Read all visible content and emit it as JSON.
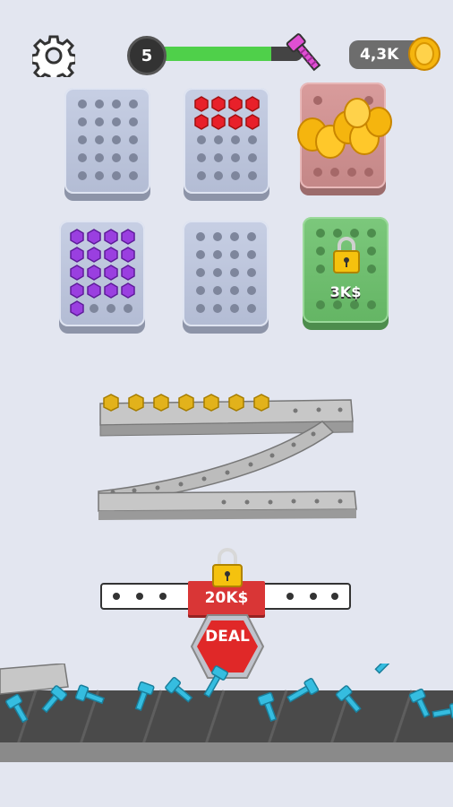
{
  "hud": {
    "level_number": "5",
    "level_progress": 0.78,
    "coins": "4,3K",
    "settings_icon": "gear-icon",
    "goal_icon": "bolt-icon",
    "coin_icon": "coin-icon"
  },
  "boards": [
    {
      "name": "board-empty-1",
      "state": "empty",
      "filled": 0,
      "color": "#b3bcd4"
    },
    {
      "name": "board-red-nuts",
      "state": "partial",
      "filled": 8,
      "nut_color": "#e8202a"
    },
    {
      "name": "board-locked-red",
      "state": "locked",
      "color": "#c48787"
    },
    {
      "name": "board-purple-nuts",
      "state": "partial",
      "filled": 17,
      "nut_color": "#9a3fe0"
    },
    {
      "name": "board-empty-2",
      "state": "empty",
      "filled": 0
    },
    {
      "name": "board-locked-green",
      "state": "locked",
      "price": "3K$",
      "color": "#64b564"
    }
  ],
  "rails": {
    "top_rail_nuts": 7,
    "nut_color": "#e2b21b"
  },
  "deal": {
    "price": "20K$",
    "label": "DEAL",
    "button_color": "#e02828"
  },
  "conveyor": {
    "bolt_color": "#35bde0"
  }
}
